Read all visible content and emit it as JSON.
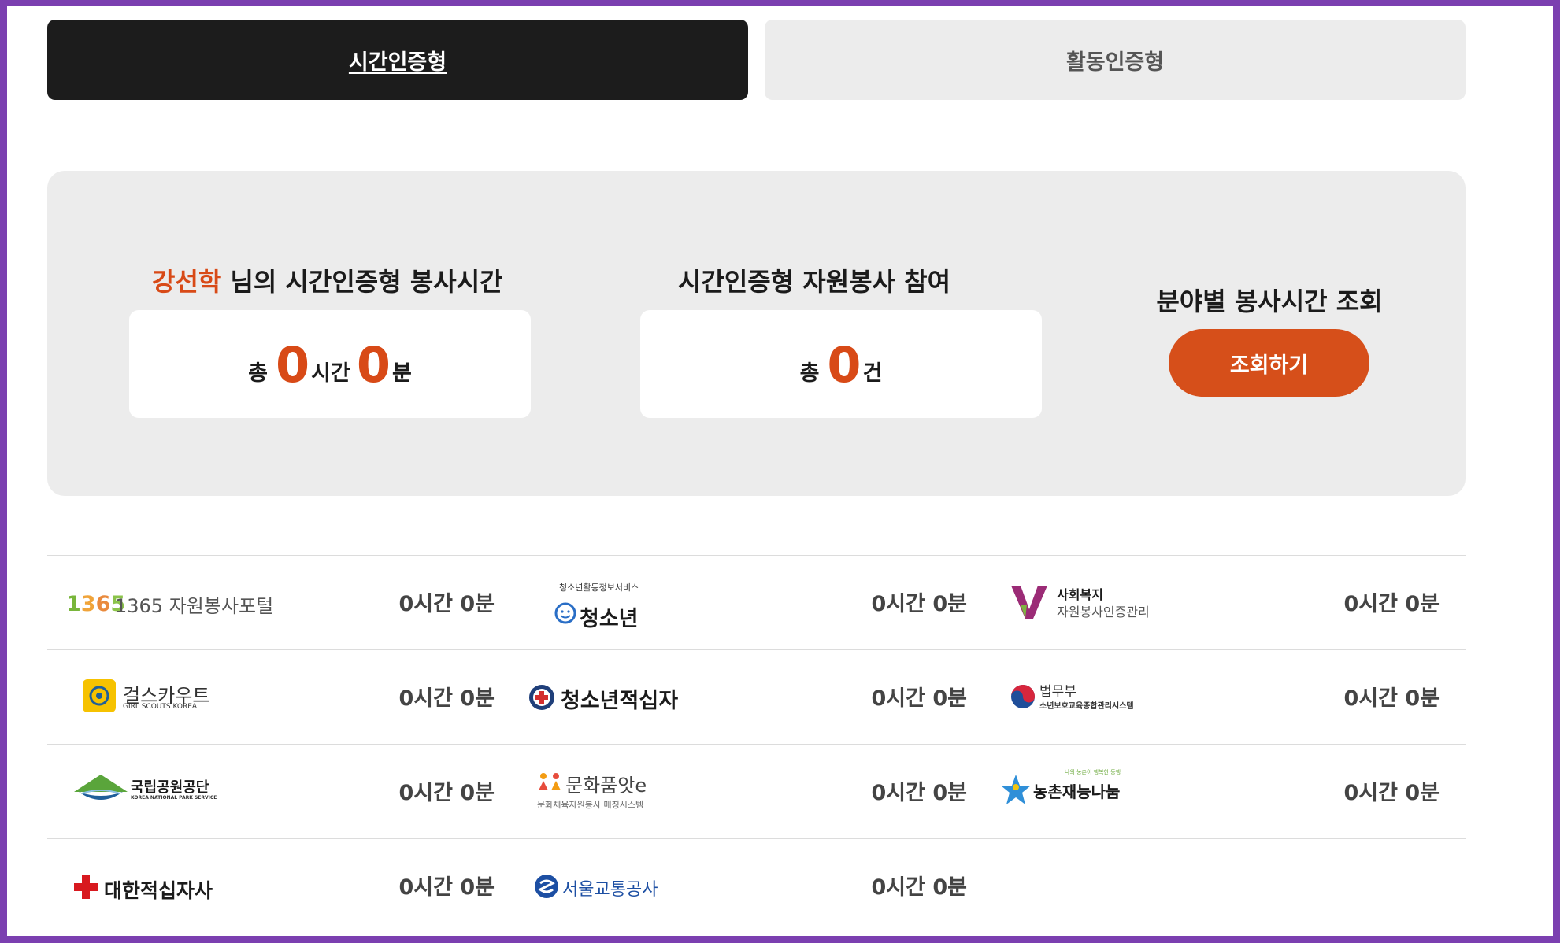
{
  "tabs": {
    "time_label": "시간인증형",
    "activity_label": "활동인증형"
  },
  "summary": {
    "user_name": "강선학",
    "hours_title_suffix": " 님의 시간인증형 봉사시간",
    "hours_prefix": "총",
    "hours_value": "0",
    "hours_unit": "시간",
    "minutes_value": "0",
    "minutes_unit": "분",
    "participation_title": "시간인증형 자원봉사 참여",
    "count_prefix": "총",
    "count_value": "0",
    "count_unit": "건",
    "field_title": "분야별 봉사시간 조회",
    "lookup_button": "조회하기"
  },
  "colors": {
    "accent": "#d84a17",
    "active_tab": "#1c1c1c",
    "panel": "#ececec"
  },
  "rows": [
    [
      {
        "logo": "1365 자원봉사포털",
        "icon": "1365-logo",
        "hours": "0시간 0분"
      },
      {
        "logo_top": "청소년활동정보서비스",
        "logo": "청소년",
        "icon": "youth-smile-logo",
        "hours": "0시간 0분"
      },
      {
        "logo": "사회복지",
        "logo_sub": "자원봉사인증관리",
        "icon": "v-logo",
        "hours": "0시간 0분"
      }
    ],
    [
      {
        "logo": "걸스카우트",
        "logo_sub": "GIRL SCOUTS KOREA",
        "icon": "girl-scouts-logo",
        "hours": "0시간 0분"
      },
      {
        "logo": "청소년적십자",
        "icon": "red-cross-circle-logo",
        "hours": "0시간 0분"
      },
      {
        "logo": "법무부",
        "logo_sub": "소년보호교육종합관리시스템",
        "icon": "taegeuk-logo",
        "hours": "0시간 0분"
      }
    ],
    [
      {
        "logo": "국립공원공단",
        "logo_sub": "KOREA NATIONAL PARK SERVICE",
        "icon": "mountain-logo",
        "hours": "0시간 0분"
      },
      {
        "logo": "문화품앗e",
        "logo_sub": "문화체육자원봉사 매칭시스템",
        "icon": "people-logo",
        "hours": "0시간 0분"
      },
      {
        "logo_top": "나의 농촌이 행복한 동행",
        "logo": "농촌재능나눔",
        "icon": "star-people-logo",
        "hours": "0시간 0분"
      }
    ],
    [
      {
        "logo": "대한적십자사",
        "icon": "red-cross-logo",
        "hours": "0시간 0분"
      },
      {
        "logo": "서울교통공사",
        "icon": "seoul-metro-logo",
        "hours": "0시간 0분"
      }
    ]
  ]
}
